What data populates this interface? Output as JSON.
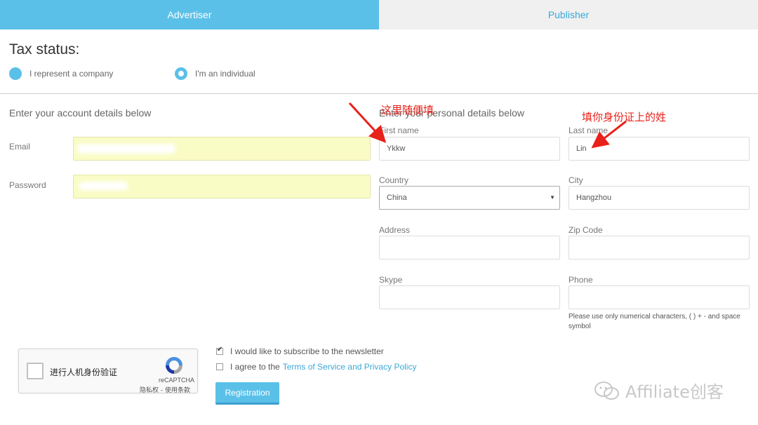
{
  "tabs": [
    {
      "label": "Advertiser",
      "active": true
    },
    {
      "label": "Publisher",
      "active": false
    }
  ],
  "tax": {
    "title": "Tax status:",
    "options": [
      {
        "label": "I represent a company",
        "checked": false
      },
      {
        "label": "I'm an individual",
        "checked": true
      }
    ]
  },
  "account": {
    "heading": "Enter your account details below",
    "email_label": "Email",
    "password_label": "Password"
  },
  "personal": {
    "heading": "Enter your personal details below",
    "first_name_label": "First name",
    "first_name_value": "Ykkw",
    "last_name_label": "Last name",
    "last_name_value": "Lin",
    "country_label": "Country",
    "country_value": "China",
    "city_label": "City",
    "city_value": "Hangzhou",
    "address_label": "Address",
    "address_value": "",
    "zip_label": "Zip Code",
    "zip_value": "",
    "skype_label": "Skype",
    "skype_value": "",
    "phone_label": "Phone",
    "phone_value": "",
    "phone_hint": "Please use only numerical characters, ( ) + - and space symbol"
  },
  "annotations": {
    "first_name_note": "这里随便填",
    "last_name_note": "填你身份证上的姓"
  },
  "captcha": {
    "text": "进行人机身份验证",
    "brand": "reCAPTCHA",
    "links": "隐私权 - 使用条款"
  },
  "agreements": {
    "newsletter_label": "I would like to subscribe to the newsletter",
    "newsletter_checked": true,
    "terms_prefix": "I agree to the",
    "terms_link": "Terms of Service and Privacy Policy",
    "terms_checked": false
  },
  "register_label": "Registration",
  "watermark": "Affiliate创客",
  "colors": {
    "accent": "#5bc0e8",
    "link": "#3aa8d8",
    "annotation": "#e8211a",
    "autofill": "#fafcc6"
  }
}
